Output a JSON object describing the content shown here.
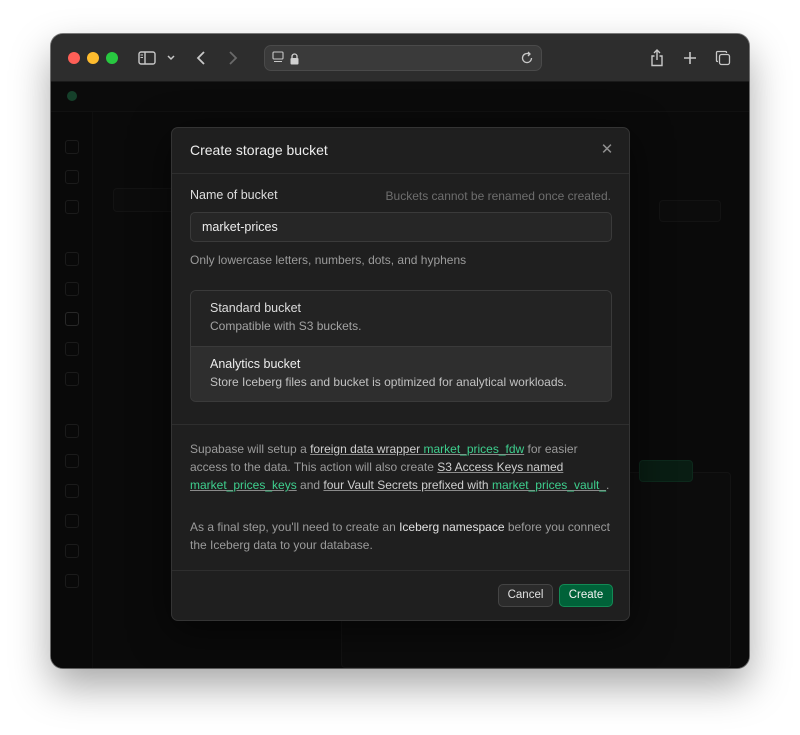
{
  "browser": {
    "url": ""
  },
  "modal": {
    "title": "Create storage bucket",
    "name_label": "Name of bucket",
    "name_hint": "Buckets cannot be renamed once created.",
    "name_value": "market-prices",
    "name_help": "Only lowercase letters, numbers, dots, and hyphens",
    "options": [
      {
        "title": "Standard bucket",
        "description": "Compatible with S3 buckets.",
        "selected": false
      },
      {
        "title": "Analytics bucket",
        "description": "Store Iceberg files and bucket is optimized for analytical workloads.",
        "selected": true
      }
    ],
    "info": {
      "p1_a": "Supabase will setup a ",
      "link_fdw_text": "foreign data wrapper ",
      "link_fdw_name": "market_prices_fdw",
      "p1_b": " for easier access to the data. This action will also create ",
      "link_keys_text": "S3 Access Keys named ",
      "link_keys_name": "market_prices_keys",
      "p1_c": " and ",
      "link_vault_text": "four Vault Secrets prefixed with ",
      "link_vault_name": "market_prices_vault_",
      "p1_d": ".",
      "p2_a": "As a final step, you'll need to create an ",
      "p2_bold": "Iceberg namespace",
      "p2_b": " before you connect the Iceberg data to your database."
    },
    "cancel_label": "Cancel",
    "create_label": "Create"
  },
  "colors": {
    "accent_green": "#3ecf8e",
    "create_button": "#006239",
    "modal_bg": "#1f1f1f"
  }
}
